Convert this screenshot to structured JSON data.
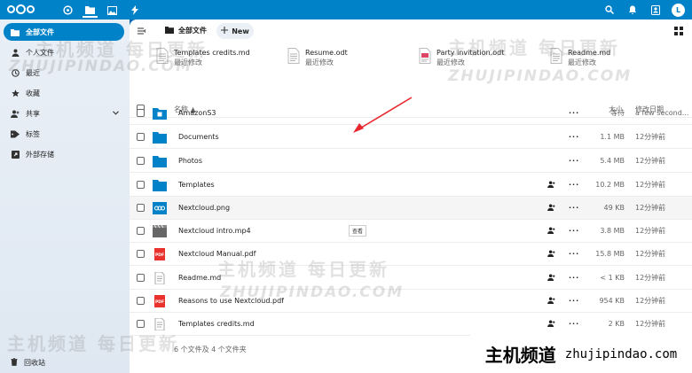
{
  "topbar": {
    "avatar_letter": "L"
  },
  "sidebar": {
    "items": [
      {
        "label": "全部文件"
      },
      {
        "label": "个人文件"
      },
      {
        "label": "最近"
      },
      {
        "label": "收藏"
      },
      {
        "label": "共享"
      },
      {
        "label": "标签"
      },
      {
        "label": "外部存储"
      }
    ],
    "trash_label": "回收站"
  },
  "main": {
    "breadcrumb": "全部文件",
    "new_label": "New",
    "recent": [
      {
        "name": "Templates credits.md",
        "sub": "最近修改"
      },
      {
        "name": "Resume.odt",
        "sub": "最近修改"
      },
      {
        "name": "Party invitation.odt",
        "sub": "最近修改"
      },
      {
        "name": "Readme.md",
        "sub": "最近修改"
      }
    ],
    "columns": {
      "name": "名称",
      "size": "大小",
      "modified": "修改日期"
    },
    "files": [
      {
        "name": "AmazonS3",
        "size": "等待",
        "modified": "a few second..."
      },
      {
        "name": "Documents",
        "size": "1.1 MB",
        "modified": "12分钟前"
      },
      {
        "name": "Photos",
        "size": "5.4 MB",
        "modified": "12分钟前"
      },
      {
        "name": "Templates",
        "size": "10.2 MB",
        "modified": "12分钟前"
      },
      {
        "name": "Nextcloud.png",
        "size": "49 KB",
        "modified": "12分钟前"
      },
      {
        "name": "Nextcloud intro.mp4",
        "size": "3.8 MB",
        "modified": "12分钟前"
      },
      {
        "name": "Nextcloud Manual.pdf",
        "size": "15.8 MB",
        "modified": "12分钟前"
      },
      {
        "name": "Readme.md",
        "size": "< 1 KB",
        "modified": "12分钟前"
      },
      {
        "name": "Reasons to use Nextcloud.pdf",
        "size": "954 KB",
        "modified": "12分钟前"
      },
      {
        "name": "Templates credits.md",
        "size": "2 KB",
        "modified": "12分钟前"
      }
    ],
    "summary": "6 个文件及 4 个文件夹",
    "tooltip": "查看"
  },
  "watermark": {
    "cn": "主机频道 每日更新",
    "latin": "ZHUJIPINDAO.COM",
    "banner_cn": "主机频道",
    "banner_domain": "zhujipindao.com"
  }
}
